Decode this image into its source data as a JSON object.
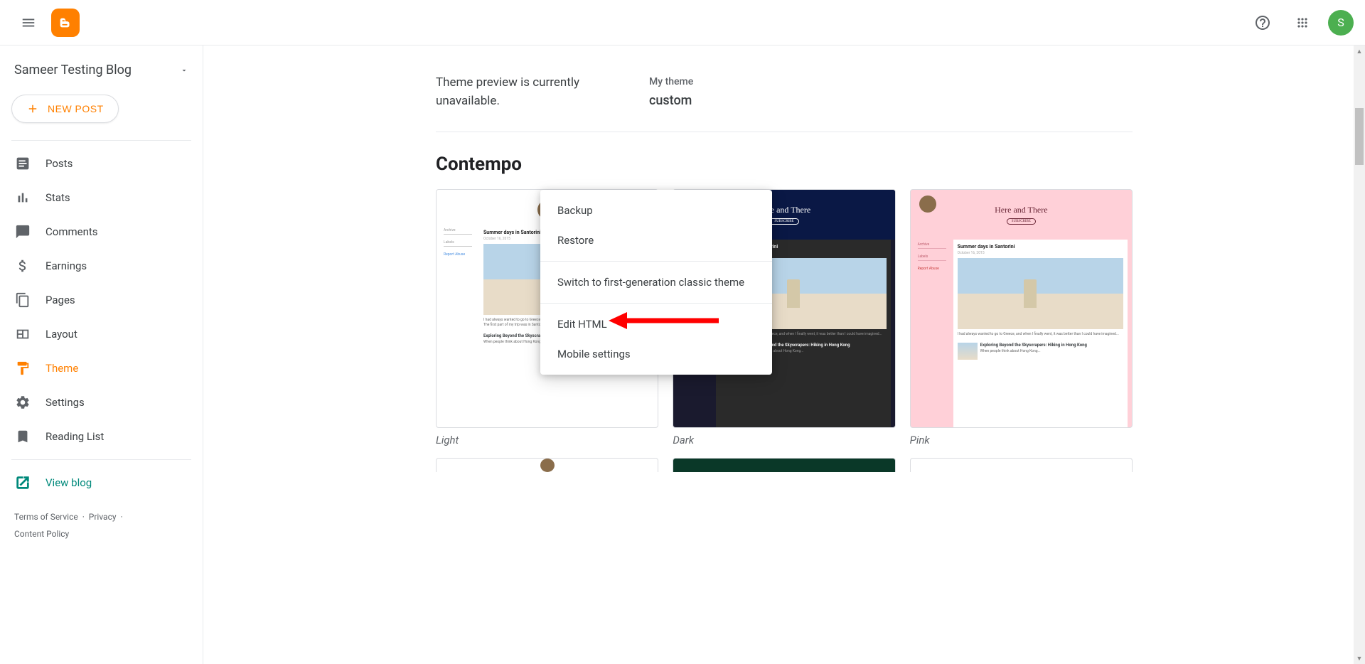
{
  "header": {
    "avatar_initial": "S"
  },
  "sidebar": {
    "blog_name": "Sameer Testing Blog",
    "new_post": "NEW POST",
    "items": [
      {
        "label": "Posts"
      },
      {
        "label": "Stats"
      },
      {
        "label": "Comments"
      },
      {
        "label": "Earnings"
      },
      {
        "label": "Pages"
      },
      {
        "label": "Layout"
      },
      {
        "label": "Theme"
      },
      {
        "label": "Settings"
      },
      {
        "label": "Reading List"
      }
    ],
    "view_blog": "View blog",
    "legal": {
      "tos": "Terms of Service",
      "privacy": "Privacy",
      "content_policy": "Content Policy"
    }
  },
  "main": {
    "preview_unavailable": "Theme preview is currently unavailable.",
    "my_theme_label": "My theme",
    "my_theme_name": "custom",
    "category": "Contempo",
    "themes": [
      {
        "name": "Light"
      },
      {
        "name": "Dark"
      },
      {
        "name": "Pink"
      }
    ],
    "thumb": {
      "header_title": "Here and There",
      "post1_title": "Summer days in Santorini",
      "post2_title": "Exploring Beyond the Skyscrapers: Hiking in Hong Kong"
    }
  },
  "dropdown": {
    "backup": "Backup",
    "restore": "Restore",
    "classic": "Switch to first-generation classic theme",
    "edit_html": "Edit HTML",
    "mobile": "Mobile settings"
  }
}
